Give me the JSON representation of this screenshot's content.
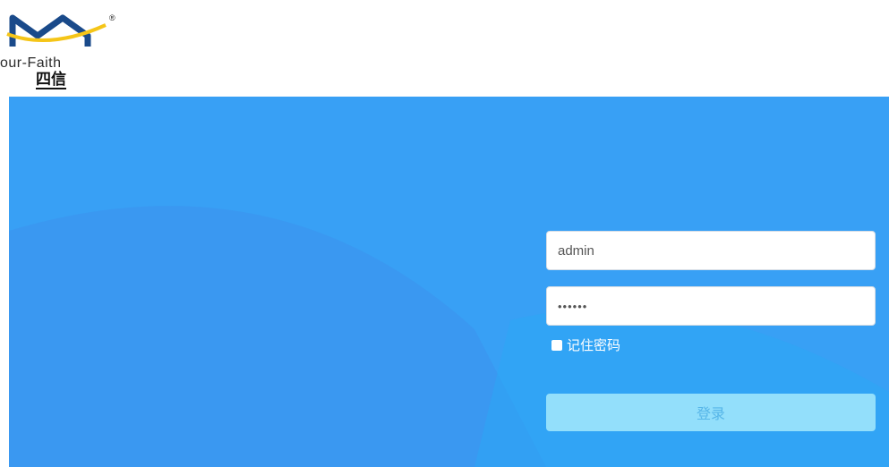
{
  "logo": {
    "brand_text": "our-Faith",
    "brand_cn": "四信",
    "registered": "®"
  },
  "login": {
    "username_value": "admin",
    "password_value": "••••••",
    "remember_label": "记住密码",
    "submit_label": "登录"
  },
  "colors": {
    "banner": "#38a0f5",
    "button": "#93dffb",
    "button_text": "#57b6e8",
    "logo_accent": "#f5c518",
    "logo_mark": "#1a4a8a"
  }
}
